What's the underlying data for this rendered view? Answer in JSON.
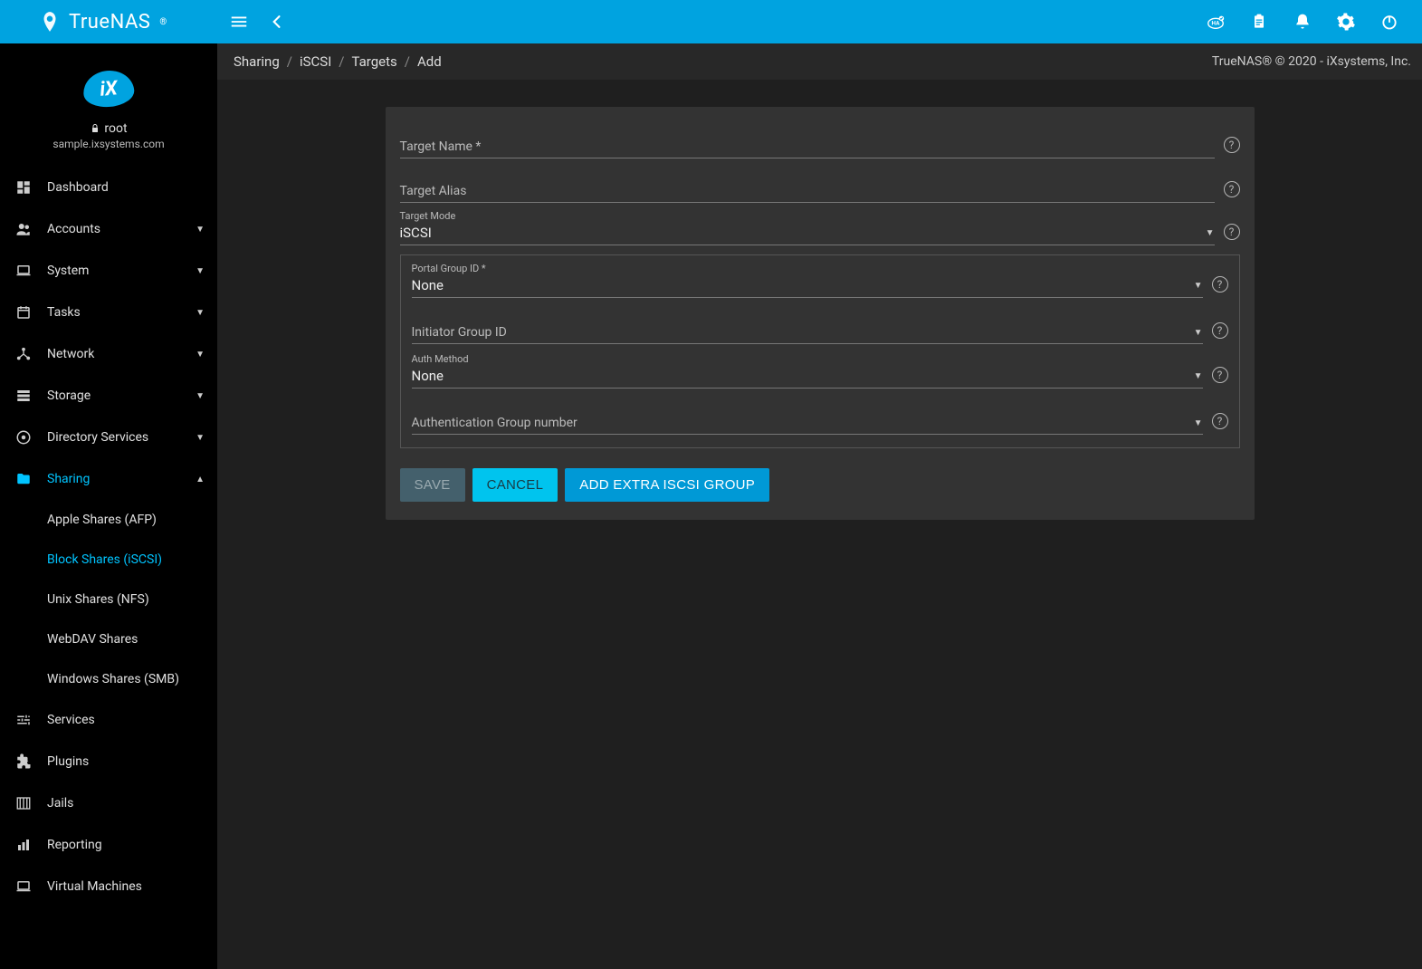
{
  "brand": "TrueNAS",
  "user": {
    "name": "root",
    "host": "sample.ixsystems.com"
  },
  "breadcrumb": {
    "items": [
      "Sharing",
      "iSCSI",
      "Targets",
      "Add"
    ]
  },
  "footer_text": "TrueNAS® © 2020 - iXsystems, Inc.",
  "sidebar": {
    "items": [
      {
        "label": "Dashboard",
        "icon": "dashboard",
        "expandable": false
      },
      {
        "label": "Accounts",
        "icon": "people",
        "expandable": true
      },
      {
        "label": "System",
        "icon": "laptop",
        "expandable": true
      },
      {
        "label": "Tasks",
        "icon": "calendar",
        "expandable": true
      },
      {
        "label": "Network",
        "icon": "network",
        "expandable": true
      },
      {
        "label": "Storage",
        "icon": "storage",
        "expandable": true
      },
      {
        "label": "Directory Services",
        "icon": "sports",
        "expandable": true
      },
      {
        "label": "Sharing",
        "icon": "folder-shared",
        "expandable": true,
        "active": true
      },
      {
        "label": "Services",
        "icon": "tune",
        "expandable": false
      },
      {
        "label": "Plugins",
        "icon": "extension",
        "expandable": false
      },
      {
        "label": "Jails",
        "icon": "jail",
        "expandable": false
      },
      {
        "label": "Reporting",
        "icon": "chart",
        "expandable": false
      },
      {
        "label": "Virtual Machines",
        "icon": "laptop",
        "expandable": false
      }
    ],
    "sharing_sub": [
      {
        "label": "Apple Shares (AFP)"
      },
      {
        "label": "Block Shares (iSCSI)",
        "active": true
      },
      {
        "label": "Unix Shares (NFS)"
      },
      {
        "label": "WebDAV Shares"
      },
      {
        "label": "Windows Shares (SMB)"
      }
    ]
  },
  "form": {
    "target_name_label": "Target Name *",
    "target_alias_label": "Target Alias",
    "target_mode_label": "Target Mode",
    "target_mode_value": "iSCSI",
    "portal_group_label": "Portal Group ID *",
    "portal_group_value": "None",
    "initiator_group_label": "Initiator Group ID",
    "initiator_group_value": "",
    "auth_method_label": "Auth Method",
    "auth_method_value": "None",
    "auth_group_num_label": "Authentication Group number",
    "auth_group_num_value": "",
    "buttons": {
      "save": "SAVE",
      "cancel": "CANCEL",
      "add_extra": "ADD EXTRA ISCSI GROUP"
    }
  }
}
